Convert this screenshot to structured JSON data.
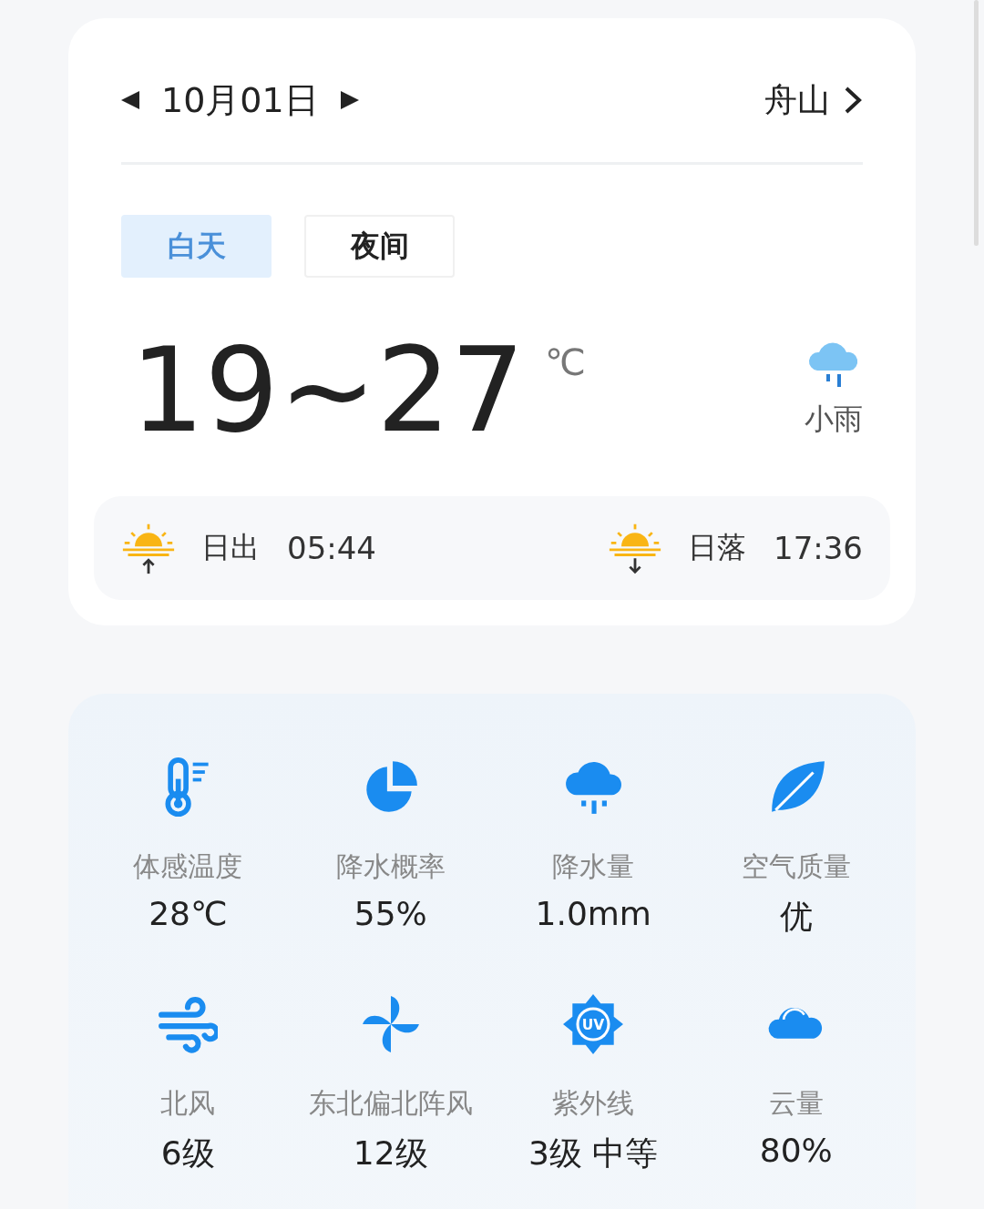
{
  "header": {
    "date": "10月01日",
    "city": "舟山"
  },
  "tabs": [
    {
      "label": "白天",
      "selected": true
    },
    {
      "label": "夜间",
      "selected": false
    }
  ],
  "forecast": {
    "temperature": "19~27",
    "unit": "℃",
    "condition": "小雨"
  },
  "sun": [
    {
      "kind": "sunrise",
      "label": "日出",
      "time": "05:44"
    },
    {
      "kind": "sunset",
      "label": "日落",
      "time": "17:36"
    }
  ],
  "details": [
    {
      "kind": "thermometer",
      "label": "体感温度",
      "value": "28℃"
    },
    {
      "kind": "pie",
      "label": "降水概率",
      "value": "55%"
    },
    {
      "kind": "rain",
      "label": "降水量",
      "value": "1.0mm"
    },
    {
      "kind": "leaf",
      "label": "空气质量",
      "value": "优"
    },
    {
      "kind": "wind",
      "label": "北风",
      "value": "6级"
    },
    {
      "kind": "fan",
      "label": "东北偏北阵风",
      "value": "12级"
    },
    {
      "kind": "uv",
      "label": "紫外线",
      "value": "3级 中等",
      "icon_text": "UV"
    },
    {
      "kind": "cloud",
      "label": "云量",
      "value": "80%"
    }
  ]
}
